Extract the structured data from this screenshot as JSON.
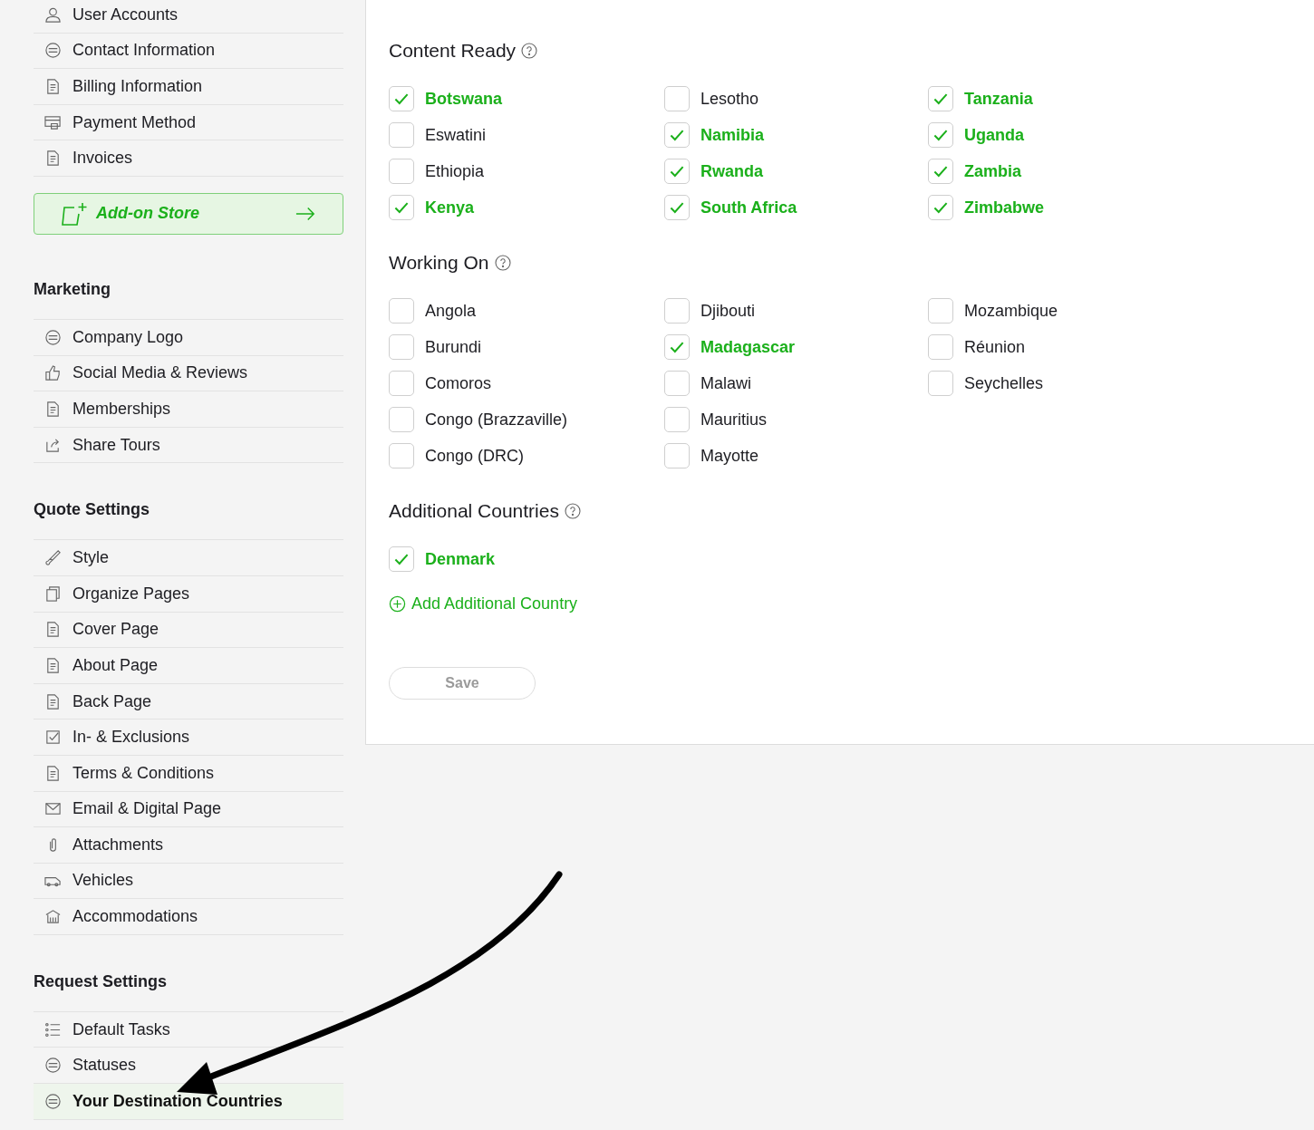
{
  "sidebar": {
    "groups": [
      {
        "items": [
          {
            "label": "User Accounts",
            "selected": false
          },
          {
            "label": "Contact Information",
            "selected": false
          },
          {
            "label": "Billing Information",
            "selected": false
          },
          {
            "label": "Payment Method",
            "selected": false
          },
          {
            "label": "Invoices",
            "selected": false
          }
        ]
      },
      {
        "title": "Marketing",
        "items": [
          {
            "label": "Company Logo",
            "selected": false
          },
          {
            "label": "Social Media & Reviews",
            "selected": false
          },
          {
            "label": "Memberships",
            "selected": false
          },
          {
            "label": "Share Tours",
            "selected": false
          }
        ]
      },
      {
        "title": "Quote Settings",
        "items": [
          {
            "label": "Style",
            "selected": false
          },
          {
            "label": "Organize Pages",
            "selected": false
          },
          {
            "label": "Cover Page",
            "selected": false
          },
          {
            "label": "About Page",
            "selected": false
          },
          {
            "label": "Back Page",
            "selected": false
          },
          {
            "label": "In- & Exclusions",
            "selected": false
          },
          {
            "label": "Terms & Conditions",
            "selected": false
          },
          {
            "label": "Email & Digital Page",
            "selected": false
          },
          {
            "label": "Attachments",
            "selected": false
          },
          {
            "label": "Vehicles",
            "selected": false
          },
          {
            "label": "Accommodations",
            "selected": false
          }
        ]
      },
      {
        "title": "Request Settings",
        "items": [
          {
            "label": "Default Tasks",
            "selected": false
          },
          {
            "label": "Statuses",
            "selected": false
          },
          {
            "label": "Your Destination Countries",
            "selected": true
          }
        ]
      }
    ],
    "addon_button": "Add-on Store"
  },
  "sections": [
    {
      "title": "Content Ready",
      "columns": [
        [
          {
            "label": "Botswana",
            "checked": true
          },
          {
            "label": "Eswatini",
            "checked": false
          },
          {
            "label": "Ethiopia",
            "checked": false
          },
          {
            "label": "Kenya",
            "checked": true
          }
        ],
        [
          {
            "label": "Lesotho",
            "checked": false
          },
          {
            "label": "Namibia",
            "checked": true
          },
          {
            "label": "Rwanda",
            "checked": true
          },
          {
            "label": "South Africa",
            "checked": true
          }
        ],
        [
          {
            "label": "Tanzania",
            "checked": true
          },
          {
            "label": "Uganda",
            "checked": true
          },
          {
            "label": "Zambia",
            "checked": true
          },
          {
            "label": "Zimbabwe",
            "checked": true
          }
        ]
      ]
    },
    {
      "title": "Working On",
      "columns": [
        [
          {
            "label": "Angola",
            "checked": false
          },
          {
            "label": "Burundi",
            "checked": false
          },
          {
            "label": "Comoros",
            "checked": false
          },
          {
            "label": "Congo (Brazzaville)",
            "checked": false
          },
          {
            "label": "Congo (DRC)",
            "checked": false
          }
        ],
        [
          {
            "label": "Djibouti",
            "checked": false
          },
          {
            "label": "Madagascar",
            "checked": true
          },
          {
            "label": "Malawi",
            "checked": false
          },
          {
            "label": "Mauritius",
            "checked": false
          },
          {
            "label": "Mayotte",
            "checked": false
          }
        ],
        [
          {
            "label": "Mozambique",
            "checked": false
          },
          {
            "label": "Réunion",
            "checked": false
          },
          {
            "label": "Seychelles",
            "checked": false
          }
        ]
      ]
    },
    {
      "title": "Additional Countries",
      "columns": [
        [
          {
            "label": "Denmark",
            "checked": true
          }
        ]
      ]
    }
  ],
  "add_country_link": "Add Additional Country",
  "save_button": {
    "label": "Save",
    "disabled": true
  }
}
